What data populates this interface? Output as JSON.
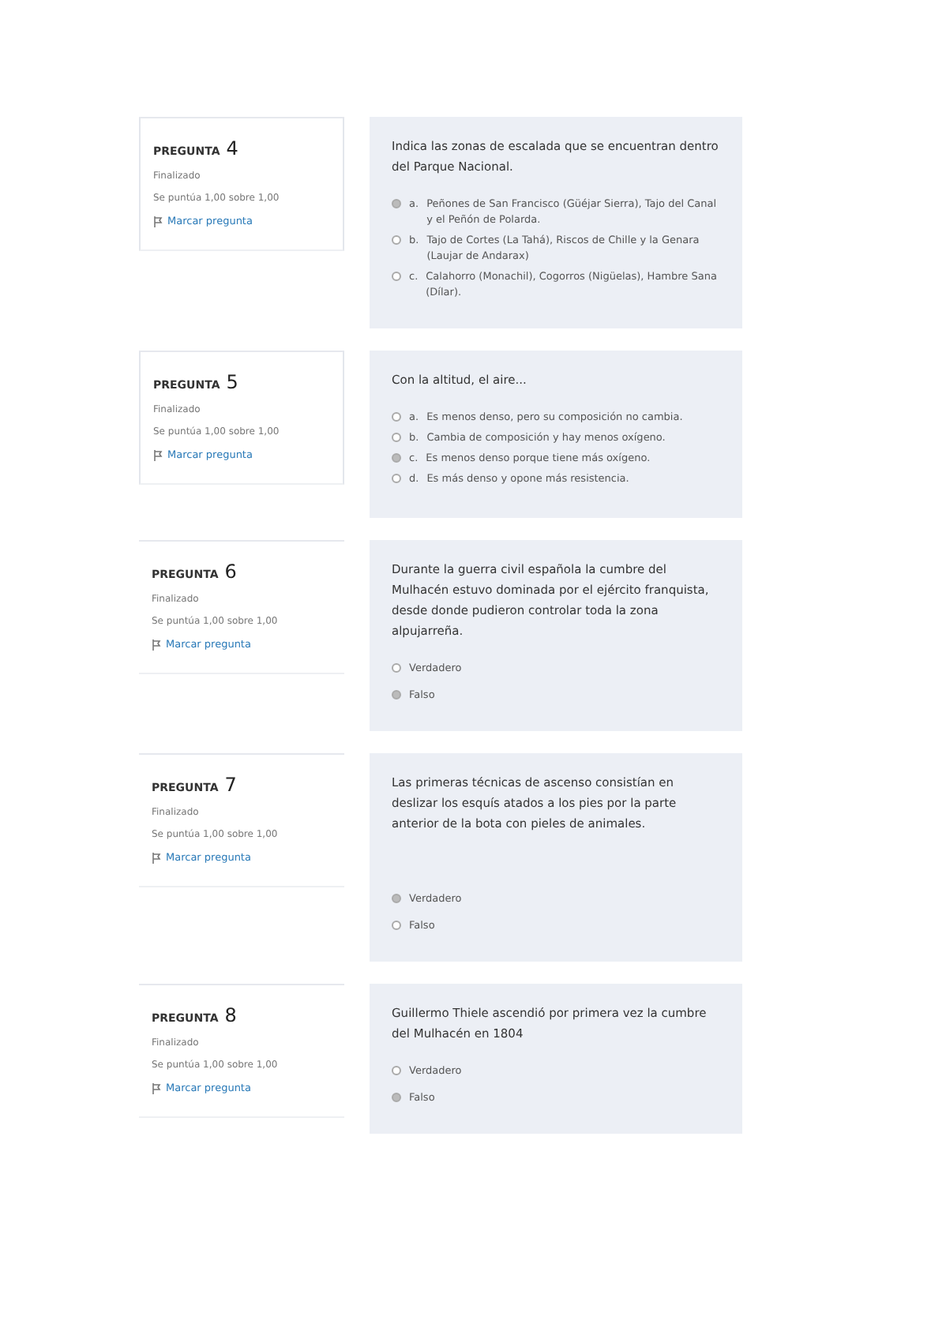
{
  "questions": [
    {
      "label": "PREGUNTA",
      "number": "4",
      "boxed": true,
      "status": "Finalizado",
      "score": "Se puntúa 1,00 sobre 1,00",
      "flag": "Marcar pregunta",
      "text": "Indica las zonas de escalada que se encuentran dentro del Parque Nacional.",
      "kind": "choice",
      "options": [
        {
          "letter": "a.",
          "text": "Peñones de San Francisco (Güéjar Sierra), Tajo del Canal y el Peñón de Polarda.",
          "selected": true
        },
        {
          "letter": "b.",
          "text": "Tajo de Cortes (La Tahá), Riscos de Chille y la Genara (Laujar de Andarax)",
          "selected": false
        },
        {
          "letter": "c.",
          "text": "Calahorro (Monachil), Cogorros (Nigüelas), Hambre Sana (Dílar).",
          "selected": false
        }
      ]
    },
    {
      "label": "PREGUNTA",
      "number": "5",
      "boxed": true,
      "status": "Finalizado",
      "score": "Se puntúa 1,00 sobre 1,00",
      "flag": "Marcar pregunta",
      "text": "Con la altitud, el aire...",
      "kind": "choice",
      "options": [
        {
          "letter": "a.",
          "text": "Es menos denso, pero su composición no cambia.",
          "selected": false
        },
        {
          "letter": "b.",
          "text": "Cambia de composición y hay menos oxígeno.",
          "selected": false
        },
        {
          "letter": "c.",
          "text": "Es menos denso porque tiene más oxígeno.",
          "selected": true
        },
        {
          "letter": "d.",
          "text": "Es más denso y opone más resistencia.",
          "selected": false
        }
      ]
    },
    {
      "label": "PREGUNTA",
      "number": "6",
      "boxed": false,
      "status": "Finalizado",
      "score": "Se puntúa 1,00 sobre 1,00",
      "flag": "Marcar pregunta",
      "text": "Durante la guerra civil española la cumbre del Mulhacén estuvo dominada por el ejército franquista, desde donde pudieron controlar toda la zona alpujarreña.",
      "kind": "truefalse",
      "options": [
        {
          "text": "Verdadero",
          "selected": false
        },
        {
          "text": "Falso",
          "selected": true
        }
      ]
    },
    {
      "label": "PREGUNTA",
      "number": "7",
      "boxed": false,
      "status": "Finalizado",
      "score": "Se puntúa 1,00 sobre 1,00",
      "flag": "Marcar pregunta",
      "text": "Las primeras técnicas de ascenso consistían en deslizar los esquís atados a los pies por la parte anterior de la bota con pieles de animales.",
      "kind": "truefalse",
      "options": [
        {
          "text": "Verdadero",
          "selected": true
        },
        {
          "text": "Falso",
          "selected": false
        }
      ]
    },
    {
      "label": "PREGUNTA",
      "number": "8",
      "boxed": false,
      "status": "Finalizado",
      "score": "Se puntúa 1,00 sobre 1,00",
      "flag": "Marcar pregunta",
      "text": "Guillermo Thiele ascendió por primera vez la cumbre del Mulhacén en 1804",
      "kind": "truefalse",
      "options": [
        {
          "text": "Verdadero",
          "selected": false
        },
        {
          "text": "Falso",
          "selected": true
        }
      ]
    }
  ]
}
